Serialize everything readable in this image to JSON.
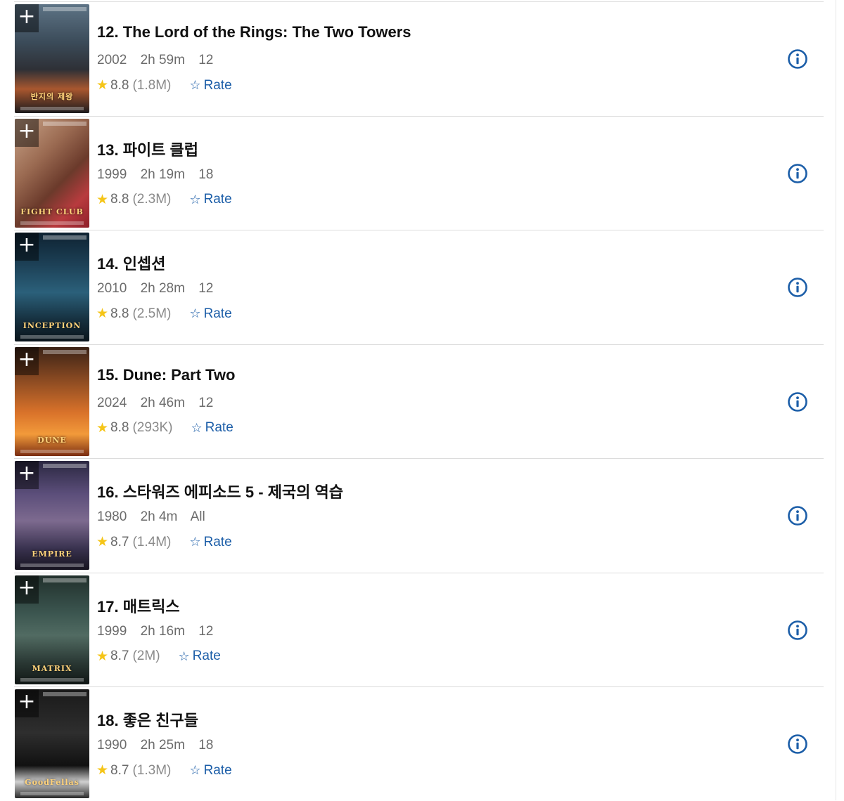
{
  "movies": [
    {
      "title": "12. The Lord of the Rings: The Two Towers",
      "year": "2002",
      "runtime": "2h 59m",
      "cert": "12",
      "rating": "8.8",
      "votes": "(1.8M)",
      "rate_label": "Rate",
      "poster_text": "반지의 제왕",
      "poster_bg": "linear-gradient(180deg,#5e7486 0%,#3b4b59 35%,#2e3036 60%,#a9572f 78%,#1b1a1c 100%)"
    },
    {
      "title": "13. 파이트 클럽",
      "year": "1999",
      "runtime": "2h 19m",
      "cert": "18",
      "rating": "8.8",
      "votes": "(2.3M)",
      "rate_label": "Rate",
      "poster_text": "FIGHT CLUB",
      "poster_bg": "linear-gradient(135deg,#caa58a 0%,#9b6b52 35%,#6b3a2b 60%,#b83b3e 80%,#8f1f2a 100%)"
    },
    {
      "title": "14. 인셉션",
      "year": "2010",
      "runtime": "2h 28m",
      "cert": "12",
      "rating": "8.8",
      "votes": "(2.5M)",
      "rate_label": "Rate",
      "poster_text": "INCEPTION",
      "poster_bg": "linear-gradient(180deg,#0e2231 0%,#1d4157 30%,#2b607a 55%,#16303f 80%,#0a141b 100%)"
    },
    {
      "title": "15. Dune: Part Two",
      "year": "2024",
      "runtime": "2h 46m",
      "cert": "12",
      "rating": "8.8",
      "votes": "(293K)",
      "rate_label": "Rate",
      "poster_text": "DUNE",
      "poster_bg": "linear-gradient(180deg,#3a2216 0%,#8a4a22 30%,#d9722a 60%,#f29a3a 80%,#7a2d12 100%)"
    },
    {
      "title": "16. 스타워즈 에피소드 5 - 제국의 역습",
      "year": "1980",
      "runtime": "2h 4m",
      "cert": "All",
      "rating": "8.7",
      "votes": "(1.4M)",
      "rate_label": "Rate",
      "poster_text": "EMPIRE",
      "poster_bg": "linear-gradient(180deg,#2a2740 0%,#5b4e7a 30%,#7d6a8f 55%,#3a3350 80%,#16131f 100%)"
    },
    {
      "title": "17. 매트릭스",
      "year": "1999",
      "runtime": "2h 16m",
      "cert": "12",
      "rating": "8.7",
      "votes": "(2M)",
      "rate_label": "Rate",
      "poster_text": "MATRIX",
      "poster_bg": "linear-gradient(180deg,#21302c 0%,#3c5650 35%,#516b62 55%,#2a3834 80%,#101615 100%)"
    },
    {
      "title": "18. 좋은 친구들",
      "year": "1990",
      "runtime": "2h 25m",
      "cert": "18",
      "rating": "8.7",
      "votes": "(1.3M)",
      "rate_label": "Rate",
      "poster_text": "GoodFellas",
      "poster_bg": "linear-gradient(180deg,#1a1a1a 0%,#2e2e2e 40%,#111111 70%,#cfcfcf 85%,#2a2a2a 100%)"
    }
  ],
  "colors": {
    "accent": "#1c5ea8",
    "star": "#f5c518",
    "title": "#111111",
    "meta": "#6b6b6b"
  },
  "icons": {
    "add": "plus-icon",
    "star": "star-icon",
    "rate": "star-outline-icon",
    "info": "info-icon"
  }
}
